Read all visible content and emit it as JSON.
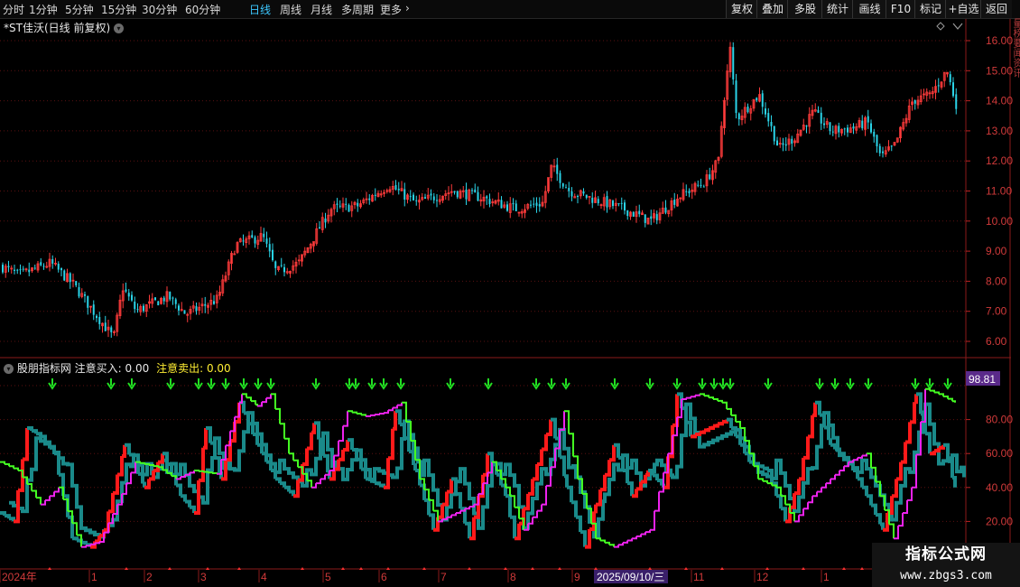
{
  "toolbar": {
    "timeframes": [
      {
        "label": "分时",
        "active": false
      },
      {
        "label": "1分钟",
        "active": false
      },
      {
        "label": "5分钟",
        "active": false
      },
      {
        "label": "15分钟",
        "active": false
      },
      {
        "label": "30分钟",
        "active": false
      },
      {
        "label": "60分钟",
        "active": false
      },
      {
        "label": "日线",
        "active": true
      },
      {
        "label": "周线",
        "active": false
      },
      {
        "label": "月线",
        "active": false
      },
      {
        "label": "多周期",
        "active": false
      },
      {
        "label": "更多",
        "active": false
      }
    ],
    "more_arrow": "›",
    "right_buttons": [
      "复权",
      "叠加",
      "多股",
      "统计",
      "画线",
      "F10",
      "标记",
      "+自选",
      "返回"
    ]
  },
  "stock": {
    "title": "*ST佳沃(日线 前复权)"
  },
  "price_axis": {
    "ticks": [
      "16.00",
      "15.00",
      "14.00",
      "13.00",
      "12.00",
      "11.00",
      "10.00",
      "9.00",
      "8.00",
      "7.00",
      "6.00"
    ]
  },
  "indicator": {
    "name": "股朋指标网",
    "buy_label": "注意买入:",
    "buy_value": "0.00",
    "sell_label": "注意卖出:",
    "sell_value": "0.00",
    "current_value_badge": "98.81",
    "axis_ticks": [
      "80.00",
      "60.00",
      "40.00",
      "20.00"
    ]
  },
  "date_axis": {
    "labels": [
      "2024年",
      "1",
      "2",
      "3",
      "4",
      "5",
      "6",
      "7",
      "8",
      "9",
      "11",
      "12",
      "1"
    ],
    "cursor_date": "2025/09/10/三"
  },
  "colors": {
    "up": "#ff3b3b",
    "down": "#2ad4e8",
    "signal_arrow": "#22e022",
    "teal_line": "#1a8a8a",
    "red_line": "#ff1a1a",
    "green_line": "#44ff22",
    "magenta_line": "#ee22ee",
    "active_tab": "#3cc8ff",
    "badge_bg": "#5a2a8a"
  },
  "watermark": {
    "title": "指标公式网",
    "url": "www.zbgs3.com"
  }
}
